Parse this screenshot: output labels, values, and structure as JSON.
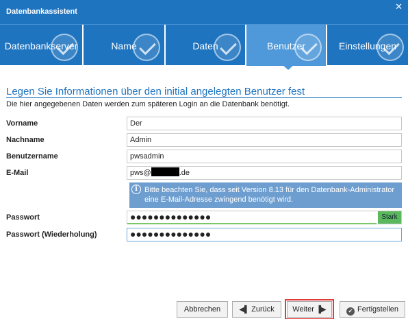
{
  "window": {
    "title": "Datenbankassistent",
    "close_glyph": "✕"
  },
  "steps": [
    {
      "label": "Datenbankserver",
      "completed": true,
      "active": false
    },
    {
      "label": "Name",
      "completed": true,
      "active": false
    },
    {
      "label": "Daten",
      "completed": true,
      "active": false
    },
    {
      "label": "Benutzer",
      "completed": false,
      "active": true
    },
    {
      "label": "Einstellungen",
      "completed": true,
      "active": false
    }
  ],
  "page": {
    "heading": "Legen Sie Informationen über den initial angelegten Benutzer fest",
    "subtitle": "Die hier angegebenen Daten werden zum späteren Login an die Datenbank benötigt."
  },
  "form": {
    "vorname": {
      "label": "Vorname",
      "value": "Der"
    },
    "nachname": {
      "label": "Nachname",
      "value": "Admin"
    },
    "benutzername": {
      "label": "Benutzername",
      "value": "pwsadmin"
    },
    "email": {
      "label": "E-Mail",
      "value_prefix": "pws@",
      "value_suffix": ".de"
    },
    "info": {
      "icon": "info-icon",
      "text": "Bitte beachten Sie, dass seit Version 8.13 für den Datenbank-Administrator eine E-Mail-Adresse zwingend benötigt wird."
    },
    "passwort": {
      "label": "Passwort",
      "value": "●●●●●●●●●●●●●●",
      "strength": "Stark",
      "strength_fraction": 0.91
    },
    "passwort_wdh": {
      "label": "Passwort (Wiederholung)",
      "value": "●●●●●●●●●●●●●●"
    }
  },
  "buttons": {
    "abbrechen": "Abbrechen",
    "zurueck": "Zurück",
    "weiter": "Weiter",
    "fertigstellen": "Fertigstellen"
  },
  "colors": {
    "accent": "#1f74c0",
    "active_step": "#4f98d9",
    "info_bg": "#6e9ed0",
    "strength_green": "#5cb85c",
    "highlight_red": "#e03c3c"
  }
}
